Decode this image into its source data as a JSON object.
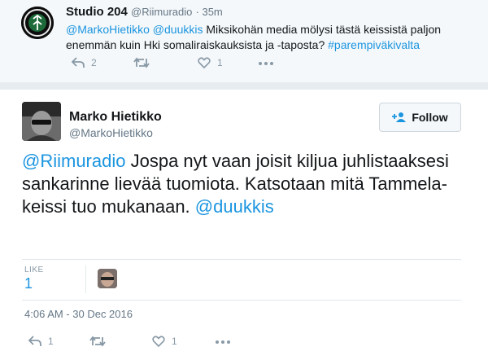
{
  "parent_tweet": {
    "name": "Studio 204",
    "handle": "@Riimuradio",
    "time": "· 35m",
    "mentions": "@MarkoHietikko @duukkis",
    "text": " Miksikohän media mölysi tästä keissistä paljon enemmän kuin Hki somaliraiskauksista ja -taposta? ",
    "hashtag": "#parempiväkivalta",
    "replies": "2",
    "likes": "1",
    "icons": [
      "reply-icon",
      "retweet-icon",
      "like-icon",
      "more-icon"
    ]
  },
  "main_tweet": {
    "name": "Marko Hietikko",
    "handle": "@MarkoHietikko",
    "follow_label": "Follow",
    "mention1": "@Riimuradio",
    "text": " Jospa nyt vaan joisit kiljua juhlistaaksesi sankarinne lievää tuomiota. Katsotaan mitä Tammela-keissi tuo mukanaan. ",
    "mention2": "@duukkis",
    "like_label": "LIKE",
    "like_count": "1",
    "date": "4:06 AM - 30 Dec 2016",
    "replies": "1",
    "likes": "1",
    "icons": [
      "reply-icon",
      "retweet-icon",
      "like-icon",
      "more-icon"
    ]
  },
  "colors": {
    "link": "#1b95e0",
    "muted": "#657786",
    "action": "#8899a6"
  }
}
